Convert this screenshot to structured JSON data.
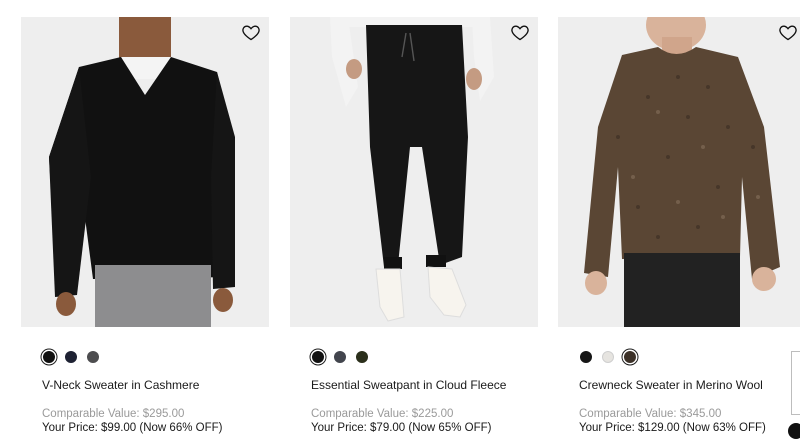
{
  "products": [
    {
      "name": "V-Neck Sweater in Cashmere",
      "comparable": "Comparable Value: $295.00",
      "your_price": "Your Price: $99.00 (Now 66% OFF)",
      "image_icon": "v-neck-sweater-image",
      "swatches": [
        {
          "color": "#111111",
          "selected": true
        },
        {
          "color": "#1e2233",
          "selected": false
        },
        {
          "color": "#4d4d4f",
          "selected": false
        }
      ]
    },
    {
      "name": "Essential Sweatpant in Cloud Fleece",
      "comparable": "Comparable Value: $225.00",
      "your_price": "Your Price: $79.00 (Now 65% OFF)",
      "image_icon": "sweatpant-image",
      "swatches": [
        {
          "color": "#111111",
          "selected": true
        },
        {
          "color": "#42454d",
          "selected": false
        },
        {
          "color": "#2b2f1b",
          "selected": false
        }
      ]
    },
    {
      "name": "Crewneck Sweater in Merino Wool",
      "comparable": "Comparable Value: $345.00",
      "your_price": "Your Price: $129.00 (Now 63% OFF)",
      "image_icon": "crewneck-sweater-image",
      "swatches": [
        {
          "color": "#161616",
          "selected": false
        },
        {
          "color": "#e6e4e0",
          "selected": false
        },
        {
          "color": "#3c3128",
          "selected": true
        }
      ]
    }
  ],
  "wishlist_icon": "heart-icon"
}
